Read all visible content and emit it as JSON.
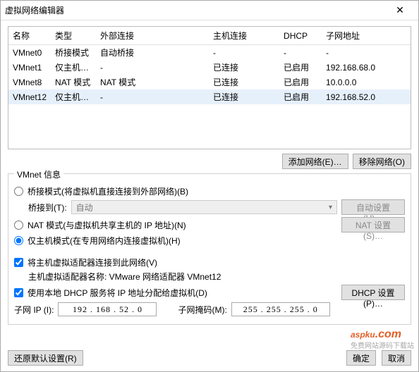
{
  "window": {
    "title": "虚拟网络编辑器"
  },
  "columns": {
    "name": "名称",
    "type": "类型",
    "ext": "外部连接",
    "host": "主机连接",
    "dhcp": "DHCP",
    "subnet": "子网地址"
  },
  "rows": [
    {
      "name": "VMnet0",
      "type": "桥接模式",
      "ext": "自动桥接",
      "host": "-",
      "dhcp": "-",
      "subnet": "-"
    },
    {
      "name": "VMnet1",
      "type": "仅主机…",
      "ext": "-",
      "host": "已连接",
      "dhcp": "已启用",
      "subnet": "192.168.68.0"
    },
    {
      "name": "VMnet8",
      "type": "NAT 模式",
      "ext": "NAT 模式",
      "host": "已连接",
      "dhcp": "已启用",
      "subnet": "10.0.0.0"
    },
    {
      "name": "VMnet12",
      "type": "仅主机…",
      "ext": "-",
      "host": "已连接",
      "dhcp": "已启用",
      "subnet": "192.168.52.0"
    }
  ],
  "buttons": {
    "add_net": "添加网络(E)…",
    "remove_net": "移除网络(O)",
    "auto_set": "自动设置(U)…",
    "nat_set": "NAT 设置(S)…",
    "dhcp_set": "DHCP 设置(P)…",
    "restore": "还原默认设置(R)",
    "ok": "确定",
    "cancel": "取消"
  },
  "group": {
    "title": "VMnet 信息",
    "radio_bridge": "桥接模式(将虚拟机直接连接到外部网络)(B)",
    "bridge_to_label": "桥接到(T):",
    "bridge_to_value": "自动",
    "radio_nat": "NAT 模式(与虚拟机共享主机的 IP 地址)(N)",
    "radio_host": "仅主机模式(在专用网络内连接虚拟机)(H)",
    "chk_connect": "将主机虚拟适配器连接到此网络(V)",
    "adapter_label": "主机虚拟适配器名称: VMware 网络适配器 VMnet12",
    "chk_dhcp": "使用本地 DHCP 服务将 IP 地址分配给虚拟机(D)",
    "subnet_ip_label": "子网 IP (I):",
    "subnet_ip": "192 . 168 . 52 . 0",
    "mask_label": "子网掩码(M):",
    "mask": "255 . 255 . 255 . 0"
  },
  "watermark": {
    "main": "aspku",
    "suffix": ".com",
    "sub": "免费网站源码下载站"
  }
}
